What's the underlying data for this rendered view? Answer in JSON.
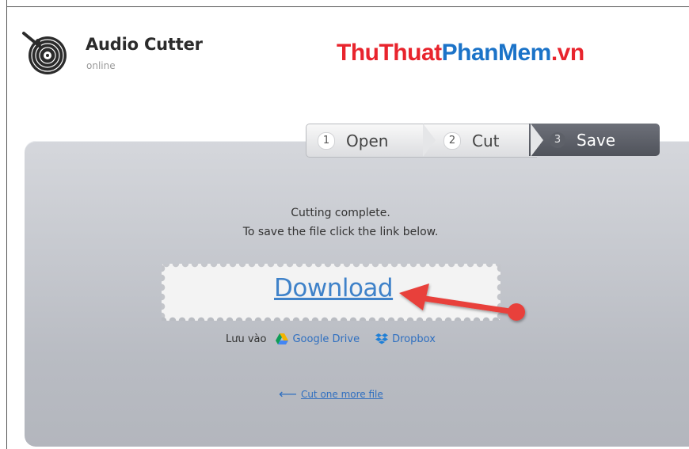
{
  "app": {
    "title": "Audio Cutter",
    "subtitle": "online",
    "logo_icon": "vinyl-scissors-icon"
  },
  "watermark": {
    "part1": "ThuThuat",
    "part2": "PhanMem",
    "part3": ".vn",
    "colors": {
      "red": "#e8242d",
      "blue": "#1b73c8"
    }
  },
  "steps": [
    {
      "number": "1",
      "label": "Open",
      "active": false
    },
    {
      "number": "2",
      "label": "Cut",
      "active": false
    },
    {
      "number": "3",
      "label": "Save",
      "active": true
    }
  ],
  "main": {
    "message_line1": "Cutting complete.",
    "message_line2": "To save the file click the link below.",
    "download_label": "Download",
    "save_to_label": "Lưu vào",
    "google_drive_label": "Google Drive",
    "dropbox_label": "Dropbox",
    "cut_more_label": "Cut one more file"
  },
  "colors": {
    "link": "#2f6fc0",
    "active_step_bg": "#5a5d65",
    "annotation_arrow": "#e8413b"
  }
}
